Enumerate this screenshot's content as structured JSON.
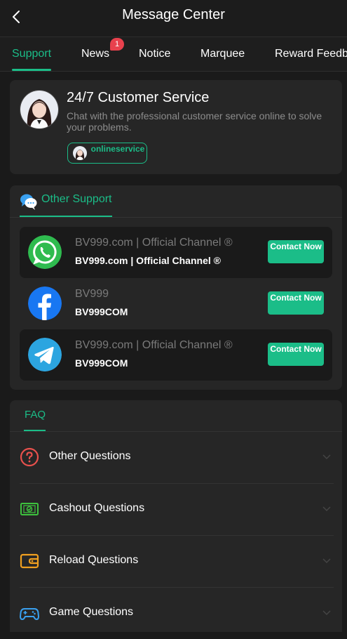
{
  "header": {
    "title": "Message Center"
  },
  "tabs": [
    {
      "label": "Support"
    },
    {
      "label": "News",
      "badge": "1"
    },
    {
      "label": "Notice"
    },
    {
      "label": "Marquee"
    },
    {
      "label": "Reward Feedback"
    }
  ],
  "customer_service": {
    "title": "24/7 Customer Service",
    "description": "Chat with the professional customer service online to solve your problems.",
    "online_label": "onlineservice"
  },
  "other_support": {
    "title": "Other Support",
    "channels": [
      {
        "icon": "whatsapp-icon",
        "name": "BV999.com | Official Channel ®",
        "id": "BV999.com | Official Channel ®",
        "button": "Contact Now"
      },
      {
        "icon": "facebook-icon",
        "name": "BV999",
        "id": "BV999COM",
        "button": "Contact Now"
      },
      {
        "icon": "telegram-icon",
        "name": "BV999.com | Official Channel ®",
        "id": "BV999COM",
        "button": "Contact Now"
      }
    ]
  },
  "faq": {
    "title": "FAQ",
    "items": [
      {
        "icon": "question-circle-icon",
        "label": "Other Questions"
      },
      {
        "icon": "cashout-icon",
        "label": "Cashout Questions"
      },
      {
        "icon": "wallet-icon",
        "label": "Reload Questions"
      },
      {
        "icon": "gamepad-icon",
        "label": "Game Questions"
      }
    ]
  },
  "colors": {
    "accent": "#1bbd88",
    "badge": "#e8414d",
    "background": "#1a1a1a",
    "card": "#262626"
  }
}
